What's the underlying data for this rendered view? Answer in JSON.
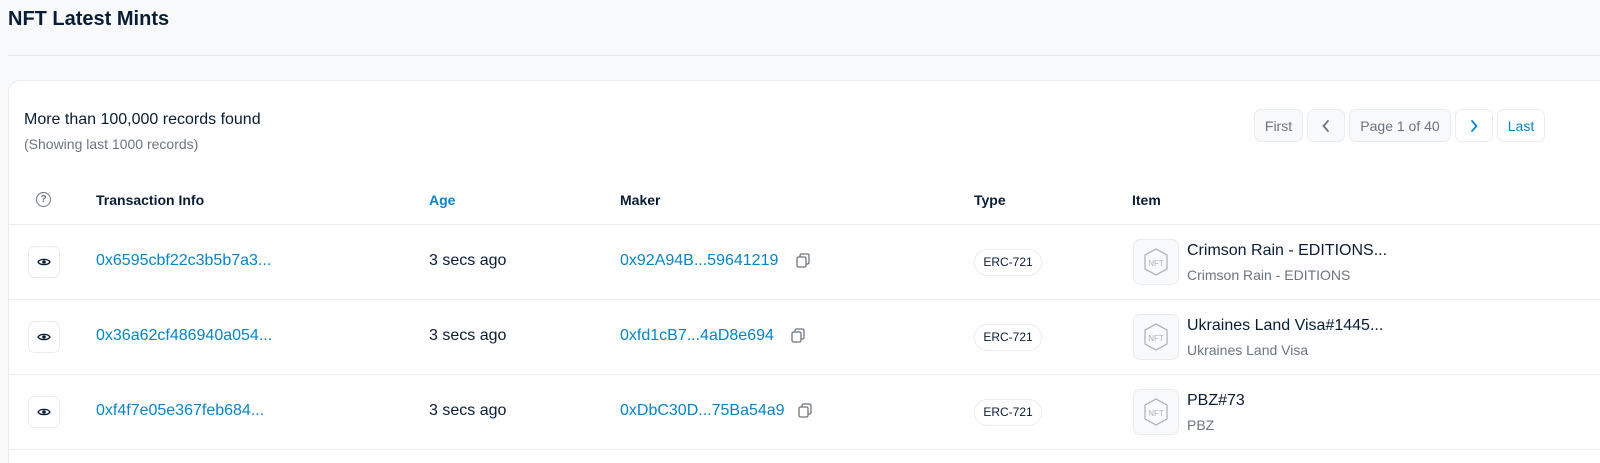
{
  "page": {
    "title": "NFT Latest Mints"
  },
  "summary": {
    "main": "More than 100,000 records found",
    "sub": "(Showing last 1000 records)"
  },
  "pagination": {
    "first": "First",
    "prev_icon": "chevron-left-icon",
    "page_info": "Page 1 of 40",
    "next_icon": "chevron-right-icon",
    "last": "Last"
  },
  "table": {
    "columns": {
      "help_icon": "question-circle-icon",
      "tx_info": "Transaction Info",
      "age": "Age",
      "maker": "Maker",
      "type": "Type",
      "item": "Item"
    },
    "rows": [
      {
        "tx_hash": "0x6595cbf22c3b5b7a3...",
        "age": "3 secs ago",
        "maker": "0x92A94B...59641219",
        "type": "ERC-721",
        "item_name": "Crimson Rain - EDITIONS...",
        "item_collection": "Crimson Rain - EDITIONS",
        "thumb_label": "NFT"
      },
      {
        "tx_hash": "0x36a62cf486940a054...",
        "age": "3 secs ago",
        "maker": "0xfd1cB7...4aD8e694",
        "type": "ERC-721",
        "item_name": "Ukraines Land Visa#1445...",
        "item_collection": "Ukraines Land Visa",
        "thumb_label": "NFT"
      },
      {
        "tx_hash": "0xf4f7e05e367feb684...",
        "age": "3 secs ago",
        "maker": "0xDbC30D...75Ba54a9",
        "type": "ERC-721",
        "item_name": "PBZ#73",
        "item_collection": "PBZ",
        "thumb_label": "NFT"
      }
    ]
  },
  "colors": {
    "link": "#0784c3",
    "text": "#081d35",
    "muted": "#6c757d",
    "border": "#e9ecef"
  }
}
